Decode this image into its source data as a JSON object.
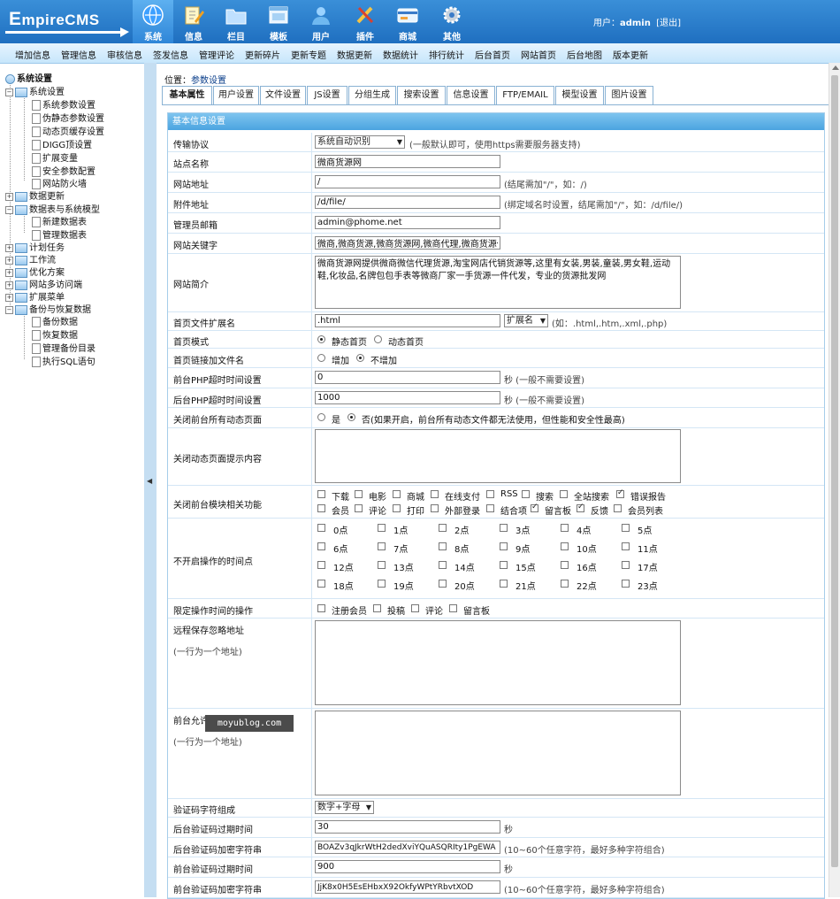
{
  "header": {
    "logo_main": "E",
    "logo_rest": "mpireCMS",
    "nav": [
      {
        "label": "系统",
        "icon": "globe-icon"
      },
      {
        "label": "信息",
        "icon": "pencil-doc-icon"
      },
      {
        "label": "栏目",
        "icon": "folder-icon"
      },
      {
        "label": "模板",
        "icon": "window-icon"
      },
      {
        "label": "用户",
        "icon": "user-icon"
      },
      {
        "label": "插件",
        "icon": "tools-icon"
      },
      {
        "label": "商城",
        "icon": "card-icon"
      },
      {
        "label": "其他",
        "icon": "gear-icon"
      }
    ],
    "user_prefix": "用户：",
    "user_name": "admin",
    "logout": "[退出]"
  },
  "subnav": [
    "增加信息",
    "管理信息",
    "审核信息",
    "签发信息",
    "管理评论",
    "更新碎片",
    "更新专题",
    "数据更新",
    "数据统计",
    "排行统计",
    "后台首页",
    "网站首页",
    "后台地图",
    "版本更新"
  ],
  "tree": {
    "root": "系统设置",
    "items": [
      "系统设置",
      "系统参数设置",
      "伪静态参数设置",
      "动态页缓存设置",
      "DIGG顶设置",
      "扩展变量",
      "安全参数配置",
      "网站防火墙",
      "数据更新",
      "数据表与系统模型",
      "新建数据表",
      "管理数据表",
      "计划任务",
      "工作流",
      "优化方案",
      "网站多访问端",
      "扩展菜单",
      "备份与恢复数据",
      "备份数据",
      "恢复数据",
      "管理备份目录",
      "执行SQL语句"
    ]
  },
  "splitter_arrow": "◀",
  "breadcrumb": {
    "prefix": "位置：",
    "link": "参数设置"
  },
  "tabs": [
    "基本属性",
    "用户设置",
    "文件设置",
    "JS设置",
    "分组生成",
    "搜索设置",
    "信息设置",
    "FTP/EMAIL",
    "模型设置",
    "图片设置"
  ],
  "form": {
    "title": "基本信息设置",
    "protocol": {
      "label": "传输协议",
      "value": "系统自动识别",
      "note": "(一般默认即可，使用https需要服务器支持)"
    },
    "site_name": {
      "label": "站点名称",
      "value": "微商货源网"
    },
    "site_url": {
      "label": "网站地址",
      "value": "/",
      "note": "(结尾需加\"/\"，如：/)"
    },
    "file_url": {
      "label": "附件地址",
      "value": "/d/file/",
      "note": "(绑定域名时设置，结尾需加\"/\"，如：/d/file/)"
    },
    "admin_email": {
      "label": "管理员邮箱",
      "value": "admin@phome.net"
    },
    "keywords": {
      "label": "网站关键字",
      "value": "微商,微商货源,微商货源网,微商代理,微商货源代"
    },
    "intro": {
      "label": "网站简介",
      "value": "微商货源网提供微商微信代理货源,淘宝网店代销货源等,这里有女装,男装,童装,男女鞋,运动鞋,化妆品,名牌包包手表等微商厂家一手货源一件代发，专业的货源批发网"
    },
    "index_ext": {
      "label": "首页文件扩展名",
      "value": ".html",
      "select": "扩展名",
      "note": "(如：.html,.htm,.xml,.php)"
    },
    "index_mode": {
      "label": "首页模式",
      "options": [
        "静态首页",
        "动态首页"
      ]
    },
    "index_link": {
      "label": "首页链接加文件名",
      "options": [
        "增加",
        "不增加"
      ]
    },
    "front_timeout": {
      "label": "前台PHP超时时间设置",
      "value": "0",
      "note": "秒 (一般不需要设置)"
    },
    "back_timeout": {
      "label": "后台PHP超时时间设置",
      "value": "1000",
      "note": "秒 (一般不需要设置)"
    },
    "close_dynamic": {
      "label": "关闭前台所有动态页面",
      "yes": "是",
      "no": "否(如果开启，前台所有动态文件都无法使用，但性能和安全性最高)"
    },
    "close_tip": {
      "label": "关闭动态页面提示内容",
      "value": ""
    },
    "close_modules": {
      "label": "关闭前台模块相关功能",
      "items": [
        {
          "t": "下载",
          "c": false
        },
        {
          "t": "电影",
          "c": false
        },
        {
          "t": "商城",
          "c": false
        },
        {
          "t": "在线支付",
          "c": false
        },
        {
          "t": "RSS",
          "c": false
        },
        {
          "t": "搜索",
          "c": false
        },
        {
          "t": "全站搜索",
          "c": false
        },
        {
          "t": "错误报告",
          "c": true
        },
        {
          "t": "会员",
          "c": false
        },
        {
          "t": "评论",
          "c": false
        },
        {
          "t": "打印",
          "c": false
        },
        {
          "t": "外部登录",
          "c": false
        },
        {
          "t": "结合项",
          "c": false
        },
        {
          "t": "留言板",
          "c": true
        },
        {
          "t": "反馈",
          "c": true
        },
        {
          "t": "会员列表",
          "c": false
        }
      ]
    },
    "no_op_hours": {
      "label": "不开启操作的时间点",
      "hours": [
        "0点",
        "1点",
        "2点",
        "3点",
        "4点",
        "5点",
        "6点",
        "7点",
        "8点",
        "9点",
        "10点",
        "11点",
        "12点",
        "13点",
        "14点",
        "15点",
        "16点",
        "17点",
        "18点",
        "19点",
        "20点",
        "21点",
        "22点",
        "23点"
      ]
    },
    "limit_ops": {
      "label": "限定操作时间的操作",
      "items": [
        "注册会员",
        "投稿",
        "评论",
        "留言板"
      ]
    },
    "remote_ignore": {
      "label": "远程保存忽略地址",
      "sub": "(一行为一个地址)",
      "value": ""
    },
    "front_allow": {
      "label": "前台允许提交的来源地址",
      "sub": "(一行为一个地址)",
      "value": ""
    },
    "captcha_chars": {
      "label": "验证码字符组成",
      "value": "数字+字母"
    },
    "back_captcha_expire": {
      "label": "后台验证码过期时间",
      "value": "30",
      "note": "秒"
    },
    "back_captcha_key": {
      "label": "后台验证码加密字符串",
      "value": "BOAZv3qJkrWtH2dedXviYQuASQRIty1PgEWA",
      "note": "(10~60个任意字符，最好多种字符组合)"
    },
    "front_captcha_expire": {
      "label": "前台验证码过期时间",
      "value": "900",
      "note": "秒"
    },
    "front_captcha_key": {
      "label": "前台验证码加密字符串",
      "value": "JjK8x0H5EsEHbxX92OkfyWPtYRbvtXOD",
      "note": "(10~60个任意字符，最好多种字符组合)"
    }
  },
  "watermark": "moyublog.com",
  "colors": {
    "header_blue": "#1f6fc0",
    "accent": "#4ba4e0"
  }
}
